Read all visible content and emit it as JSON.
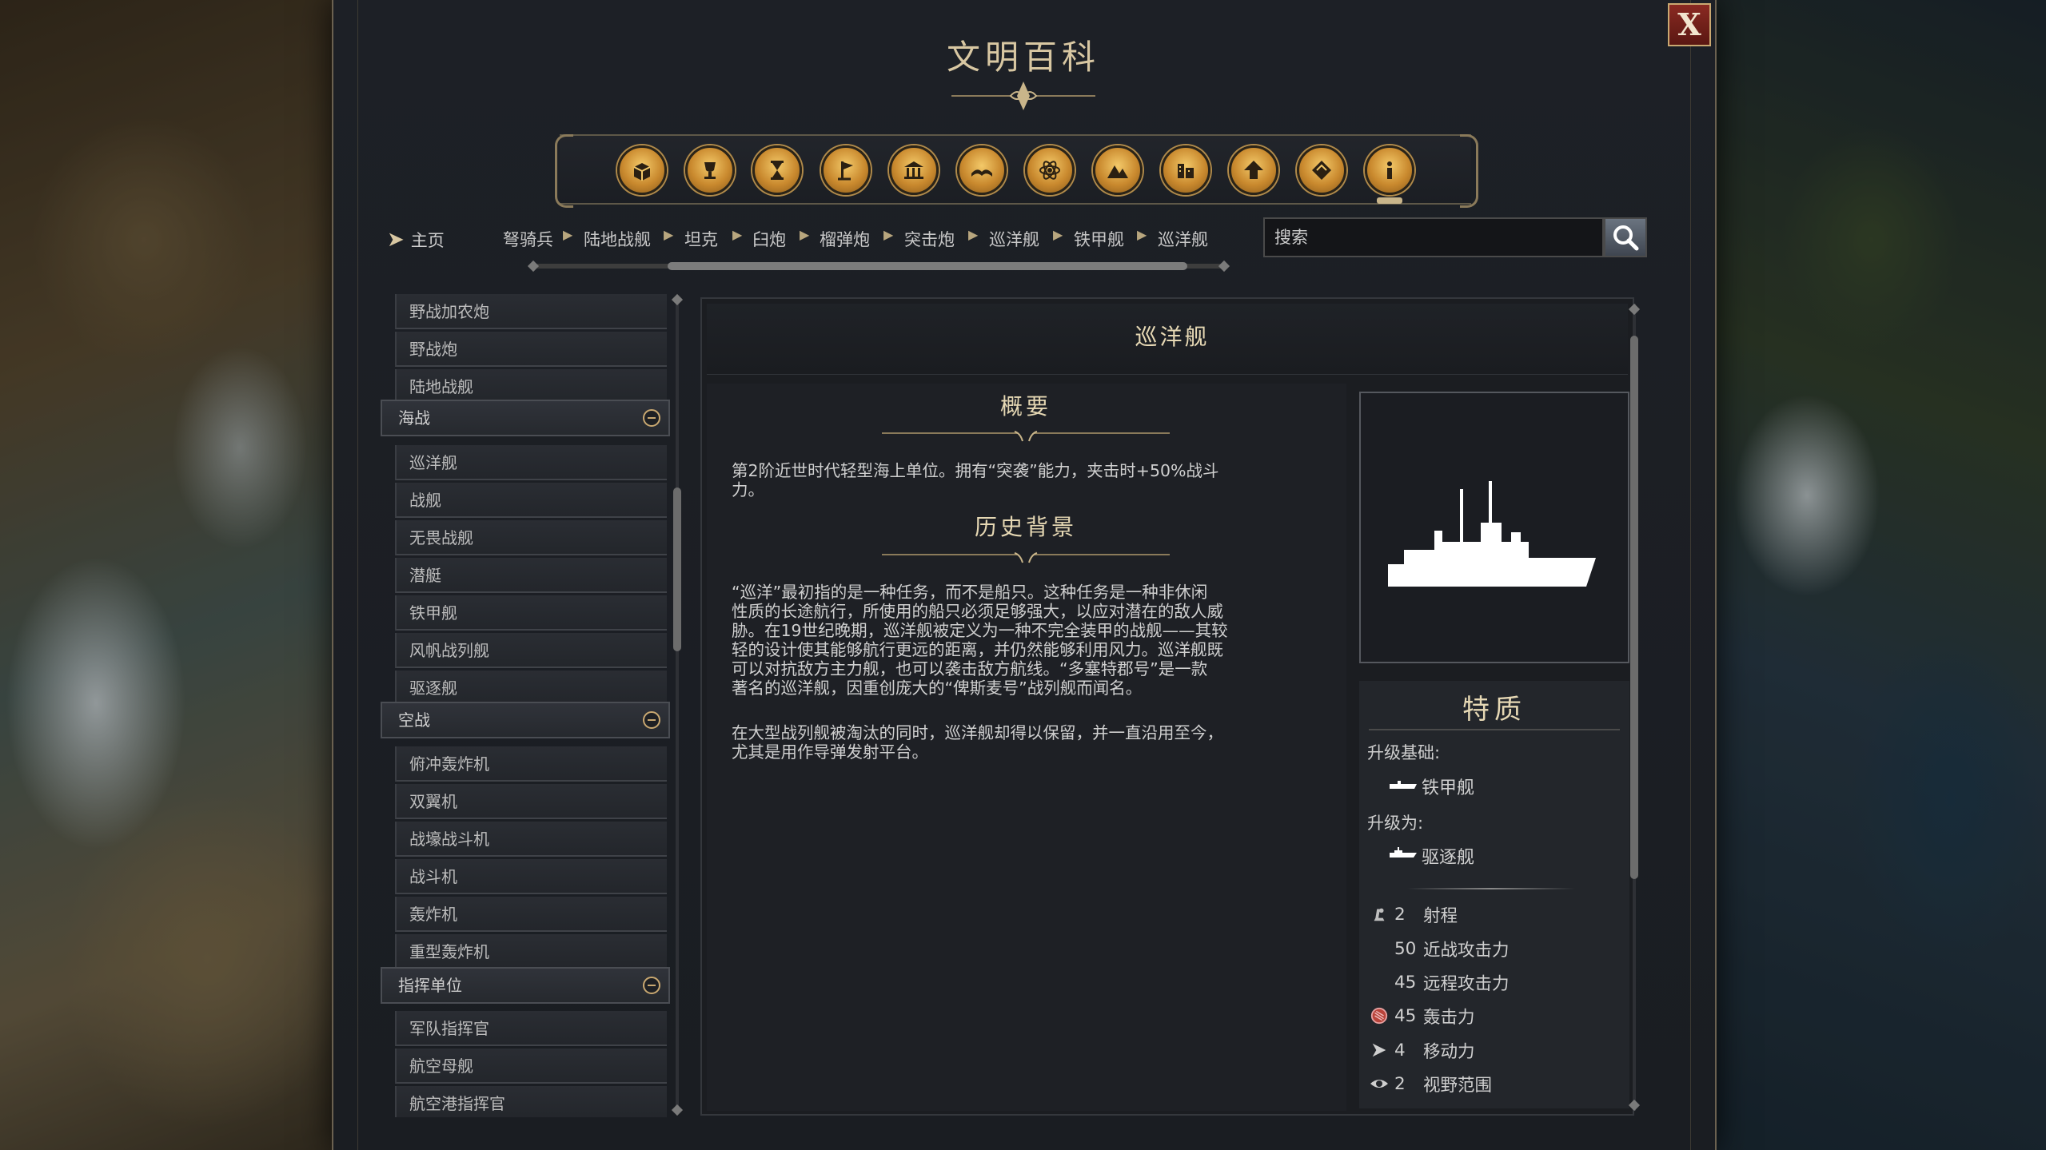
{
  "window": {
    "title": "文明百科",
    "close_label": "X"
  },
  "categories": [
    {
      "icon": "crates-icon"
    },
    {
      "icon": "trophy-icon"
    },
    {
      "icon": "hourglass-icon"
    },
    {
      "icon": "flag-icon"
    },
    {
      "icon": "building-icon"
    },
    {
      "icon": "book-icon"
    },
    {
      "icon": "atom-icon"
    },
    {
      "icon": "mountain-icon"
    },
    {
      "icon": "city-icon"
    },
    {
      "icon": "upgrade-arrow-icon"
    },
    {
      "icon": "map-icon"
    },
    {
      "icon": "info-icon"
    }
  ],
  "breadcrumb": {
    "home": "主页",
    "items": [
      "弩骑兵",
      "陆地战舰",
      "坦克",
      "臼炮",
      "榴弹炮",
      "突击炮",
      "巡洋舰",
      "铁甲舰",
      "巡洋舰"
    ]
  },
  "search": {
    "placeholder": "搜索"
  },
  "list": {
    "items_top": [
      "野战加农炮",
      "野战炮",
      "陆地战舰"
    ],
    "groups": [
      {
        "label": "海战",
        "items": [
          "巡洋舰",
          "战舰",
          "无畏战舰",
          "潜艇",
          "铁甲舰",
          "风帆战列舰",
          "驱逐舰"
        ]
      },
      {
        "label": "空战",
        "items": [
          "俯冲轰炸机",
          "双翼机",
          "战壕战斗机",
          "战斗机",
          "轰炸机",
          "重型轰炸机"
        ]
      },
      {
        "label": "指挥单位",
        "items": [
          "军队指挥官",
          "航空母舰",
          "航空港指挥官"
        ]
      }
    ]
  },
  "article": {
    "title": "巡洋舰",
    "overview_heading": "概要",
    "overview_lines": [
      "第2阶近世时代轻型海上单位。拥有“突袭”能力，夹击时+50%战斗",
      "力。"
    ],
    "history_heading": "历史背景",
    "history_p1_lines": [
      "“巡洋”最初指的是一种任务，而不是船只。这种任务是一种非休闲",
      "性质的长途航行，所使用的船只必须足够强大，以应对潜在的敌人威",
      "胁。在19世纪晚期，巡洋舰被定义为一种不完全装甲的战舰——其较",
      "轻的设计使其能够航行更远的距离，并仍然能够利用风力。巡洋舰既",
      "可以对抗敌方主力舰，也可以袭击敌方航线。“多塞特郡号”是一款",
      "著名的巡洋舰，因重创庞大的“俾斯麦号”战列舰而闻名。"
    ],
    "history_p2_lines": [
      "在大型战列舰被淘汰的同时，巡洋舰却得以保留，并一直沿用至今，",
      "尤其是用作导弹发射平台。"
    ]
  },
  "traits": {
    "title": "特质",
    "upgrade_from_label": "升级基础:",
    "upgrade_from_unit": "铁甲舰",
    "upgrade_to_label": "升级为:",
    "upgrade_to_unit": "驱逐舰",
    "stats": [
      {
        "icon": "range-icon",
        "value": "2",
        "label": "射程"
      },
      {
        "icon": "",
        "value": "50",
        "label": "近战攻击力"
      },
      {
        "icon": "",
        "value": "45",
        "label": "远程攻击力"
      },
      {
        "icon": "bombard-icon",
        "value": "45",
        "label": "轰击力"
      },
      {
        "icon": "movement-icon",
        "value": "4",
        "label": "移动力"
      },
      {
        "icon": "eye-icon",
        "value": "2",
        "label": "视野范围"
      }
    ]
  }
}
